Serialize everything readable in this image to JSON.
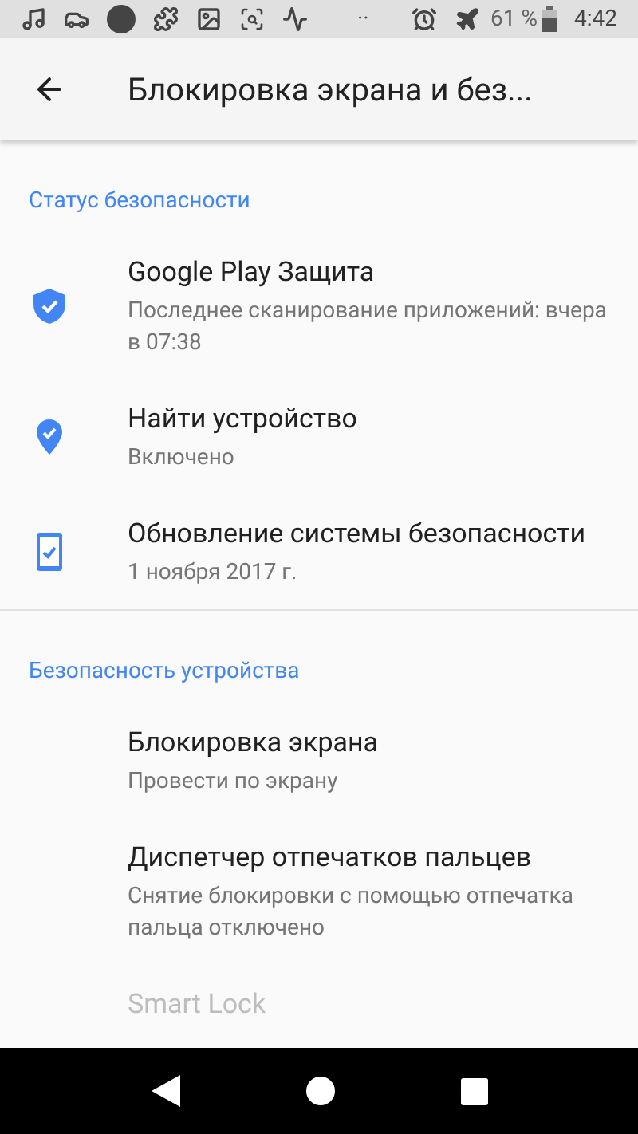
{
  "status_bar": {
    "dots": "··",
    "battery_text": "61 %",
    "time": "4:42"
  },
  "toolbar": {
    "title": "Блокировка экрана и без..."
  },
  "sections": [
    {
      "header": "Статус безопасности",
      "items": [
        {
          "kind": "shield",
          "title": "Google Play Защита",
          "subtitle": "Последнее сканирование приложений: вчера в 07:38",
          "disabled": false
        },
        {
          "kind": "pin",
          "title": "Найти устройство",
          "subtitle": "Включено",
          "disabled": false
        },
        {
          "kind": "phone",
          "title": "Обновление системы безопасности",
          "subtitle": "1 ноября 2017 г.",
          "disabled": false
        }
      ]
    },
    {
      "header": "Безопасность устройства",
      "items": [
        {
          "kind": "none",
          "title": "Блокировка экрана",
          "subtitle": "Провести по экрану",
          "disabled": false
        },
        {
          "kind": "none",
          "title": "Диспетчер отпечатков пальцев",
          "subtitle": "Снятие блокировки с помощью отпечатка пальца отключено",
          "disabled": false
        },
        {
          "kind": "none",
          "title": "Smart Lock",
          "disabled": true
        }
      ]
    }
  ]
}
